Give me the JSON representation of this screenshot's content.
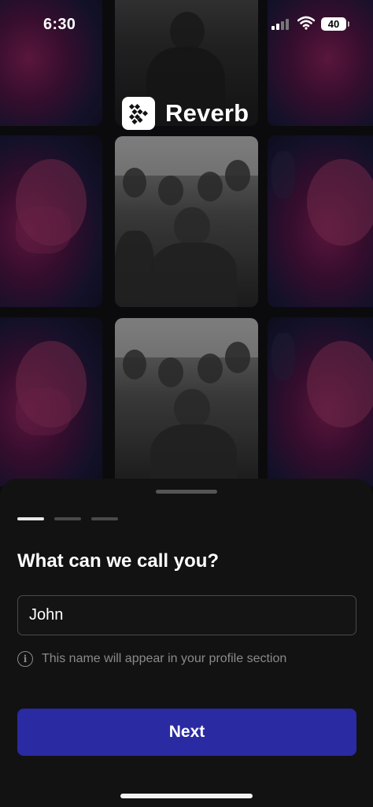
{
  "status_bar": {
    "time": "6:30",
    "battery": "40"
  },
  "app": {
    "name": "Reverb"
  },
  "onboarding": {
    "steps_total": 3,
    "current_step": 1,
    "question": "What can we call you?",
    "name_input_value": "John",
    "hint": "This name will appear in your profile section",
    "next_label": "Next"
  },
  "colors": {
    "primary_button": "#2a2aa3",
    "sheet_background": "#121212"
  },
  "icons": {
    "logo": "reverb-logo-icon",
    "info": "info-icon",
    "signal": "cellular-signal-icon",
    "wifi": "wifi-icon",
    "battery": "battery-icon"
  }
}
